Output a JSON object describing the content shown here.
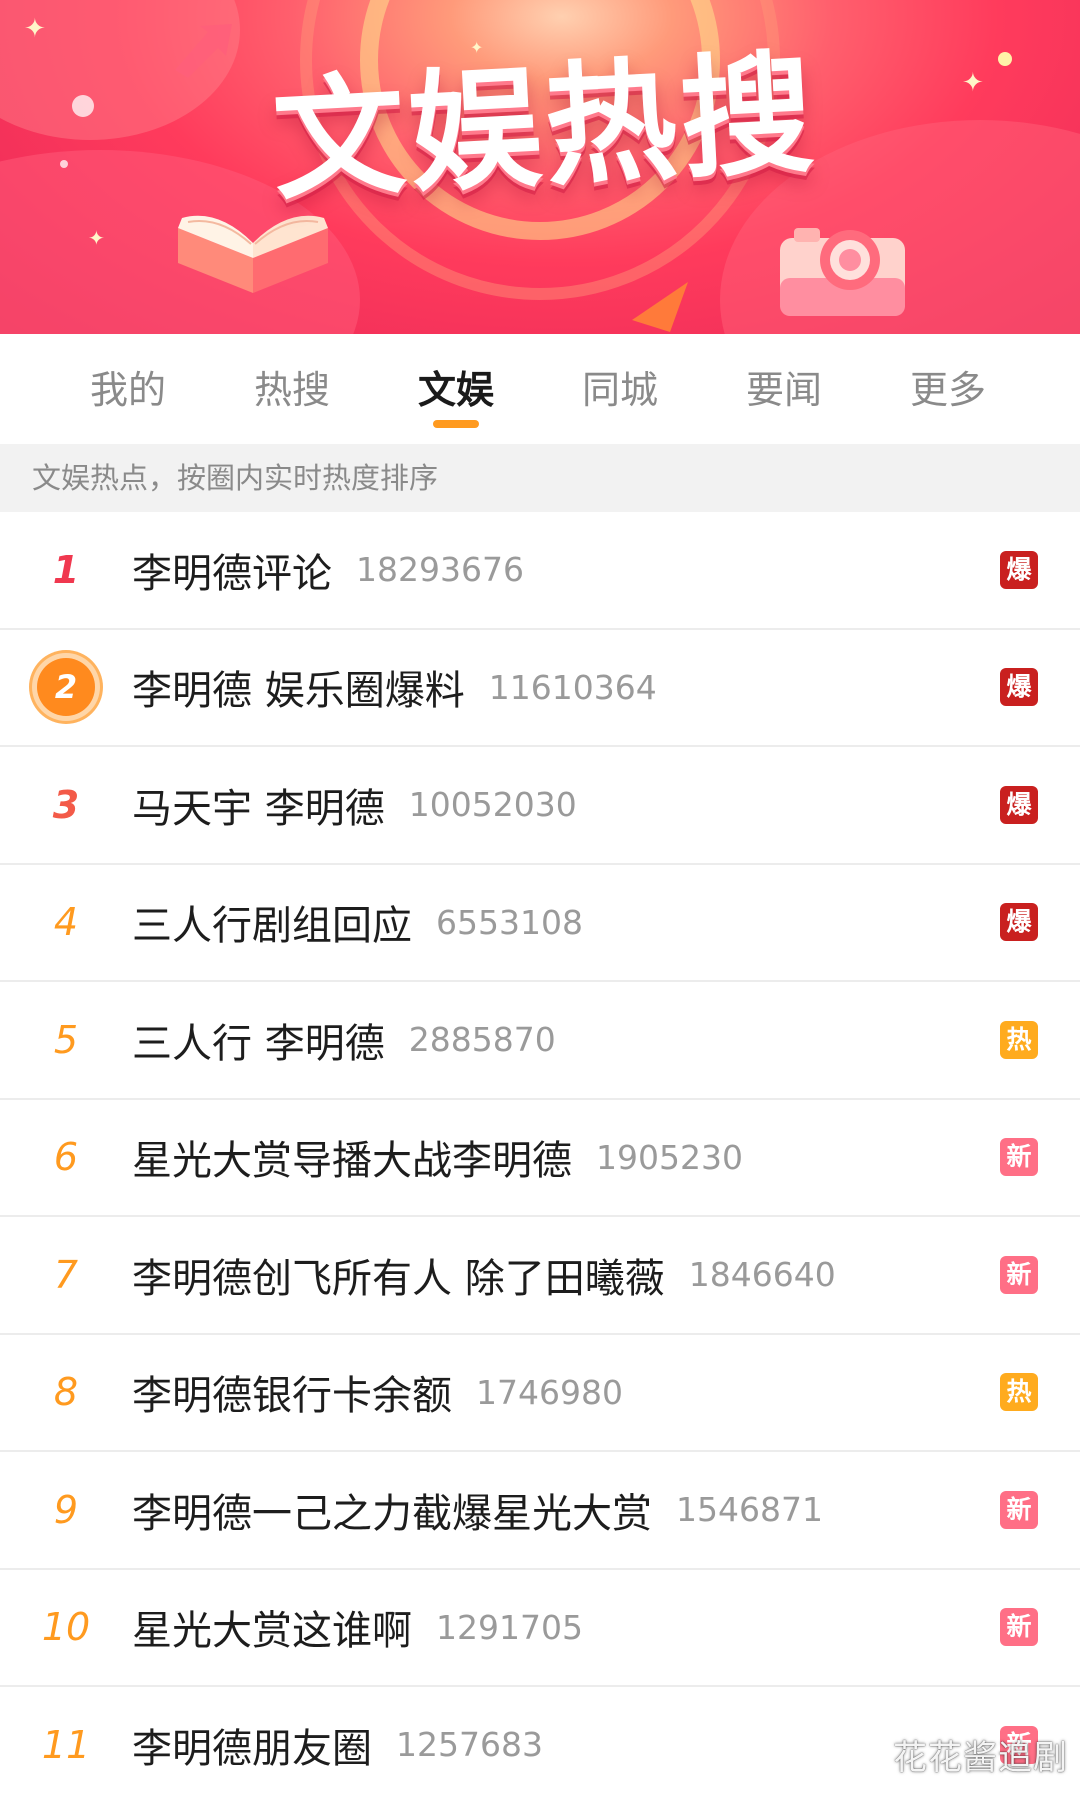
{
  "banner": {
    "title": "文娱热搜"
  },
  "tabs": [
    {
      "label": "我的",
      "active": false
    },
    {
      "label": "热搜",
      "active": false
    },
    {
      "label": "文娱",
      "active": true
    },
    {
      "label": "同城",
      "active": false
    },
    {
      "label": "要闻",
      "active": false
    },
    {
      "label": "更多",
      "active": false
    }
  ],
  "info_text": "文娱热点，按圈内实时热度排序",
  "list": [
    {
      "rank": "1",
      "topic": "李明德评论",
      "count": "18293676",
      "badge": "爆",
      "badge_color": "#c9201f"
    },
    {
      "rank": "2",
      "topic": "李明德 娱乐圈爆料",
      "count": "11610364",
      "badge": "爆",
      "badge_color": "#c9201f"
    },
    {
      "rank": "3",
      "topic": "马天宇 李明德",
      "count": "10052030",
      "badge": "爆",
      "badge_color": "#c9201f"
    },
    {
      "rank": "4",
      "topic": "三人行剧组回应",
      "count": "6553108",
      "badge": "爆",
      "badge_color": "#c9201f"
    },
    {
      "rank": "5",
      "topic": "三人行 李明德",
      "count": "2885870",
      "badge": "热",
      "badge_color": "#ffab1e"
    },
    {
      "rank": "6",
      "topic": "星光大赏导播大战李明德",
      "count": "1905230",
      "badge": "新",
      "badge_color": "#ff6f86"
    },
    {
      "rank": "7",
      "topic": "李明德创飞所有人 除了田曦薇",
      "count": "1846640",
      "badge": "新",
      "badge_color": "#ff6f86"
    },
    {
      "rank": "8",
      "topic": "李明德银行卡余额",
      "count": "1746980",
      "badge": "热",
      "badge_color": "#ffab1e"
    },
    {
      "rank": "9",
      "topic": "李明德一己之力截爆星光大赏",
      "count": "1546871",
      "badge": "新",
      "badge_color": "#ff6f86"
    },
    {
      "rank": "10",
      "topic": "星光大赏这谁啊",
      "count": "1291705",
      "badge": "新",
      "badge_color": "#ff6f86"
    },
    {
      "rank": "11",
      "topic": "李明德朋友圈",
      "count": "1257683",
      "badge": "新",
      "badge_color": "#ff6f86"
    }
  ],
  "watermark": "花花酱追剧",
  "colors": {
    "accent": "#ff9a1f",
    "banner_red": "#f2305a"
  },
  "icons": {
    "rank2": "medal-icon",
    "book": "book-icon",
    "camera": "camera-icon"
  }
}
